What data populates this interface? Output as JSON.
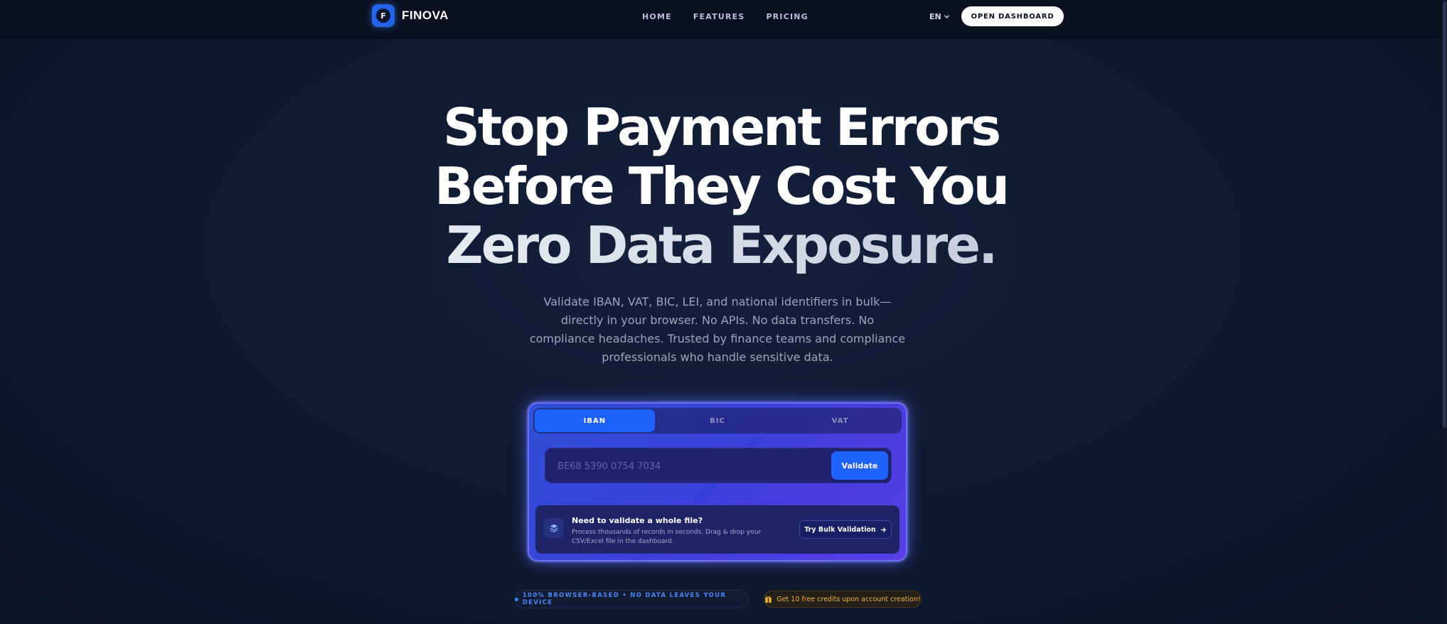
{
  "nav": {
    "logo_letter": "F",
    "brand": "FINOVA",
    "links": [
      "HOME",
      "FEATURES",
      "PRICING"
    ],
    "language": "EN",
    "cta": "OPEN DASHBOARD"
  },
  "hero": {
    "title_line1": "Stop Payment Errors",
    "title_line2": "Before They Cost You",
    "title_line3": "Zero Data Exposure.",
    "subtitle": "Validate IBAN, VAT, BIC, LEI, and national identifiers in bulk—directly in your browser. No APIs. No data transfers. No compliance headaches. Trusted by finance teams and compliance professionals who handle sensitive data."
  },
  "validator": {
    "tabs": [
      "IBAN",
      "BIC",
      "VAT"
    ],
    "active_tab": "IBAN",
    "input_placeholder": "BE68 5390 0754 7034",
    "input_value": "",
    "validate_label": "Validate"
  },
  "bulk": {
    "title": "Need to validate a whole file?",
    "description": "Process thousands of records in seconds. Drag & drop your CSV/Excel file in the dashboard.",
    "button": "Try Bulk Validation"
  },
  "badges": {
    "browser": "100% BROWSER-BASED • NO DATA LEAVES YOUR DEVICE",
    "credits": "Get 10 free credits upon account creation!"
  },
  "colors": {
    "accent": "#1f62ff",
    "background": "#0e1a30",
    "nav_background": "#0a1020",
    "credits_text": "#f0b43a"
  },
  "icons": {
    "chevron": "chevron-down-icon",
    "bulk": "layers-icon",
    "arrow": "arrow-right-icon",
    "gift": "gift-icon"
  }
}
